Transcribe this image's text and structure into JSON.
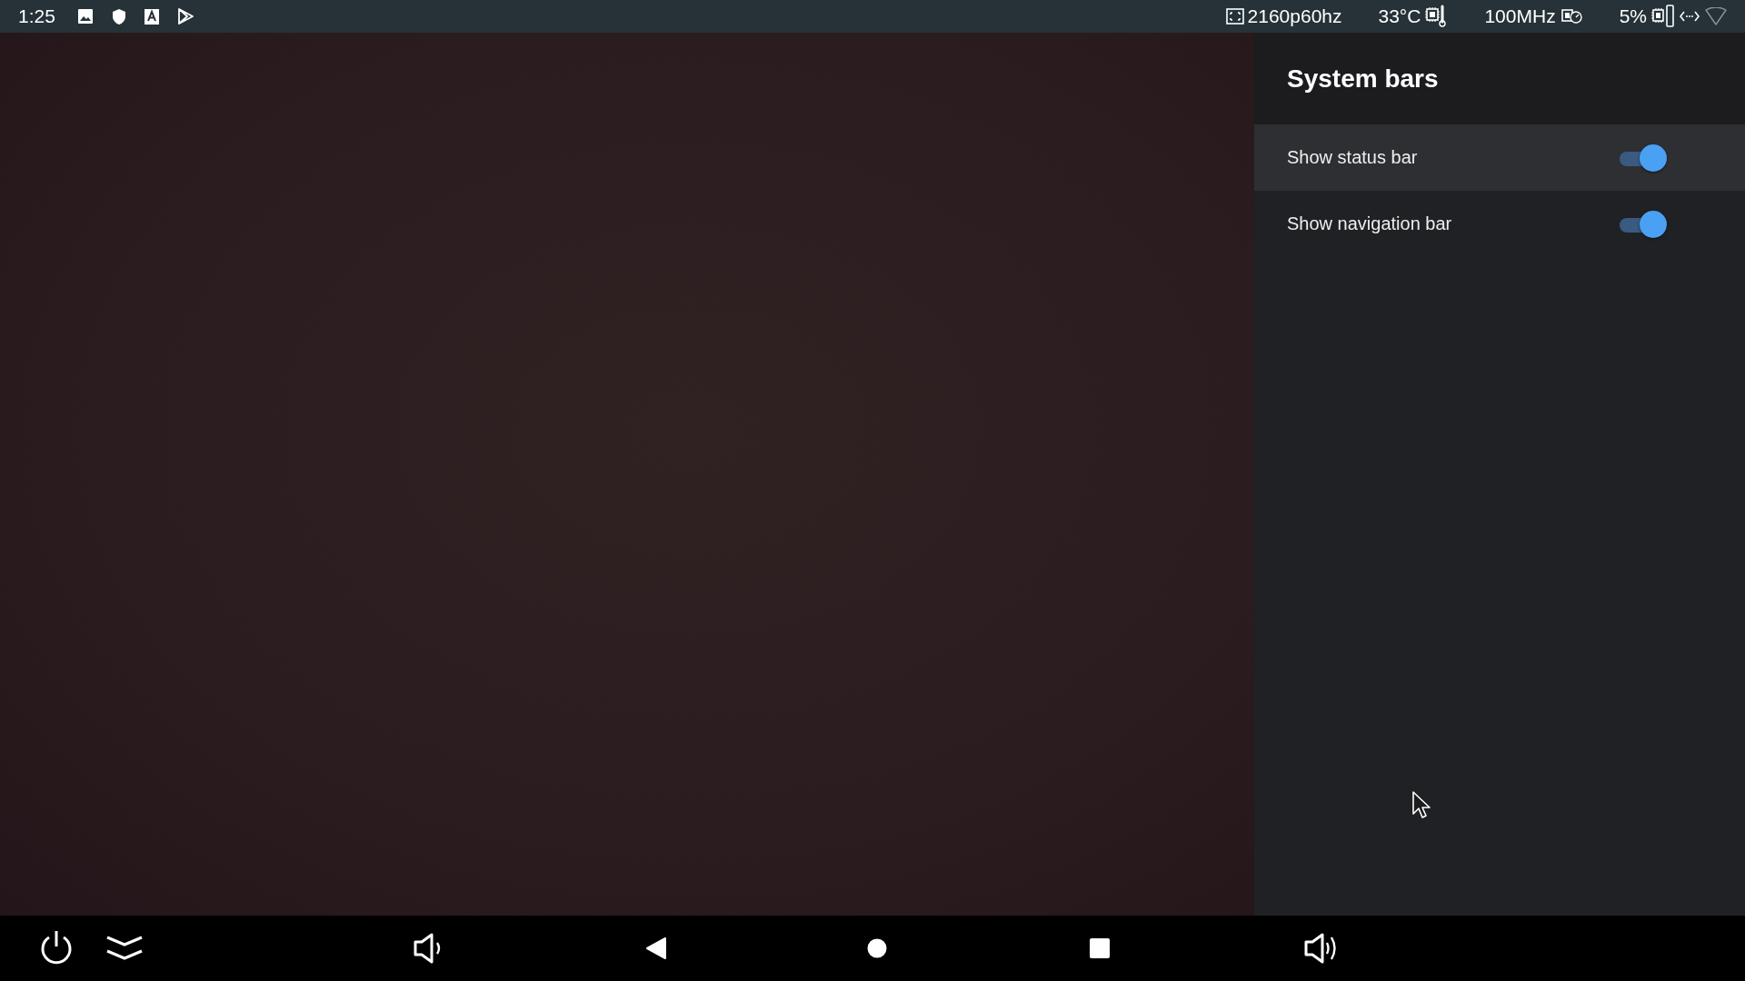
{
  "status_bar": {
    "time": "1:25",
    "resolution": "2160p60hz",
    "temperature": "33°C",
    "frequency": "100MHz",
    "load": "5%"
  },
  "panel": {
    "title": "System bars",
    "settings": [
      {
        "label": "Show status bar",
        "on": true,
        "selected": true
      },
      {
        "label": "Show navigation bar",
        "on": true,
        "selected": false
      }
    ]
  }
}
